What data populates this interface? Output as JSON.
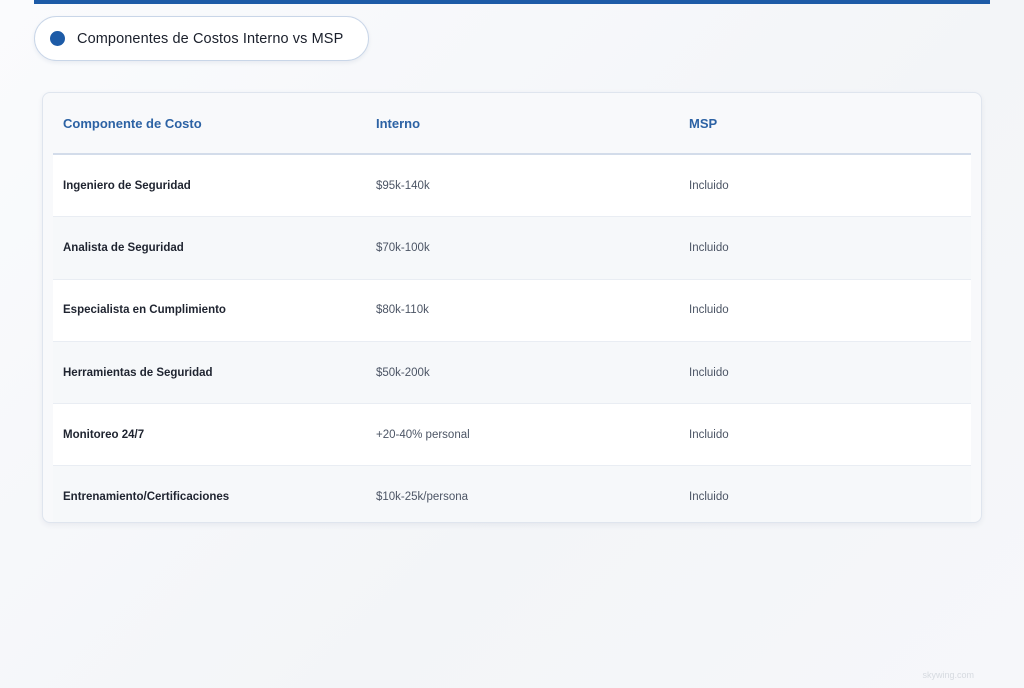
{
  "title": {
    "text": "Componentes de Costos Interno vs MSP"
  },
  "table": {
    "headers": [
      "Componente de Costo",
      "Interno",
      "MSP"
    ],
    "rows": [
      [
        "Ingeniero de Seguridad",
        "$95k-140k",
        "Incluido"
      ],
      [
        "Analista de Seguridad",
        "$70k-100k",
        "Incluido"
      ],
      [
        "Especialista en Cumplimiento",
        "$80k-110k",
        "Incluido"
      ],
      [
        "Herramientas de Seguridad",
        "$50k-200k",
        "Incluido"
      ],
      [
        "Monitoreo 24/7",
        "+20-40% personal",
        "Incluido"
      ],
      [
        "Entrenamiento/Certificaciones",
        "$10k-25k/persona",
        "Incluido"
      ]
    ]
  },
  "watermark": "skywing.com",
  "colors": {
    "accent": "#1d5ba7",
    "header_text": "#2c62a4"
  }
}
